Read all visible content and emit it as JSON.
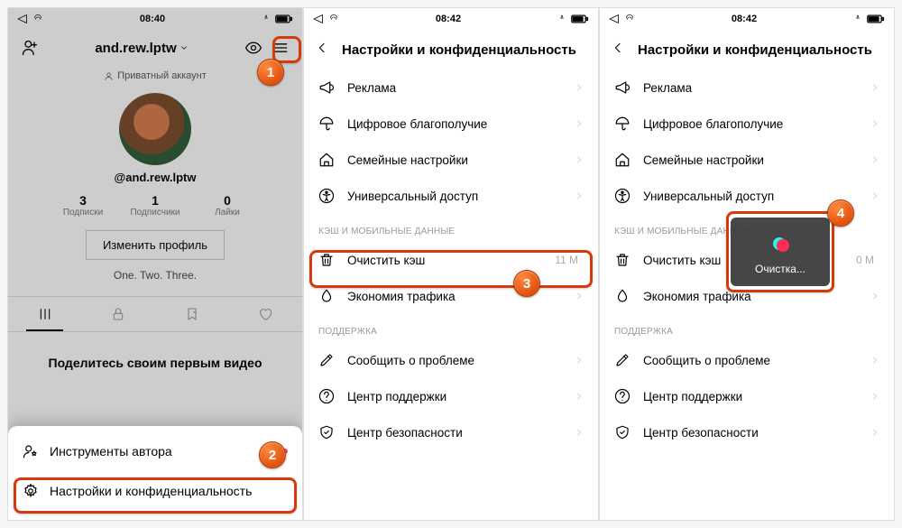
{
  "statusbar": {
    "time1": "08:40",
    "time2": "08:42",
    "time3": "08:42"
  },
  "profile": {
    "username_top": "and.rew.lptw",
    "private_label": "Приватный аккаунт",
    "handle": "@and.rew.lptw",
    "stats": [
      {
        "num": "3",
        "label": "Подписки"
      },
      {
        "num": "1",
        "label": "Подписчики"
      },
      {
        "num": "0",
        "label": "Лайки"
      }
    ],
    "edit_button": "Изменить профиль",
    "bio": "One. Two. Three.",
    "share_prompt": "Поделитесь своим первым видео"
  },
  "sheet": {
    "creator_tools": "Инструменты автора",
    "settings_privacy": "Настройки и конфиденциальность"
  },
  "settings": {
    "title": "Настройки и конфиденциальность",
    "items_top": [
      {
        "icon": "megaphone",
        "label": "Реклама"
      },
      {
        "icon": "umbrella",
        "label": "Цифровое благополучие"
      },
      {
        "icon": "home",
        "label": "Семейные настройки"
      },
      {
        "icon": "accessibility",
        "label": "Универсальный доступ"
      }
    ],
    "section_cache": "КЭШ И МОБИЛЬНЫЕ ДАННЫЕ",
    "clear_cache": {
      "label": "Очистить кэш",
      "value1": "11 M",
      "value2": "0 M"
    },
    "data_saver": "Экономия трафика",
    "section_support": "ПОДДЕРЖКА",
    "items_support": [
      {
        "icon": "pen",
        "label": "Сообщить о проблеме"
      },
      {
        "icon": "help",
        "label": "Центр поддержки"
      },
      {
        "icon": "shield",
        "label": "Центр безопасности"
      }
    ]
  },
  "toast": {
    "text": "Очистка..."
  },
  "badges": {
    "b1": "1",
    "b2": "2",
    "b3": "3",
    "b4": "4"
  }
}
